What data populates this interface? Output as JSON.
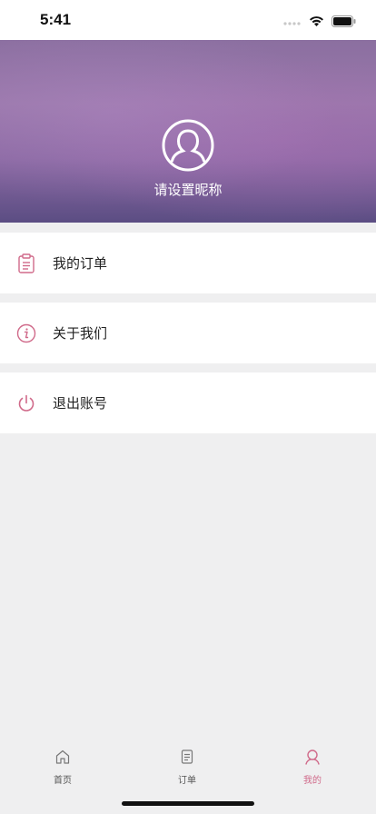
{
  "status_bar": {
    "time": "5:41"
  },
  "profile": {
    "nickname": "请设置昵称"
  },
  "menu": [
    {
      "label": "我的订单",
      "icon": "clipboard-icon"
    },
    {
      "label": "关于我们",
      "icon": "info-icon"
    },
    {
      "label": "退出账号",
      "icon": "power-icon"
    }
  ],
  "tabbar": {
    "items": [
      {
        "label": "首页",
        "icon": "home-icon",
        "active": false
      },
      {
        "label": "订单",
        "icon": "order-icon",
        "active": false
      },
      {
        "label": "我的",
        "icon": "user-icon",
        "active": true
      }
    ]
  },
  "colors": {
    "accent": "#d06a8a",
    "header_top": "#8b6fa0",
    "header_bottom": "#5b4d83"
  }
}
